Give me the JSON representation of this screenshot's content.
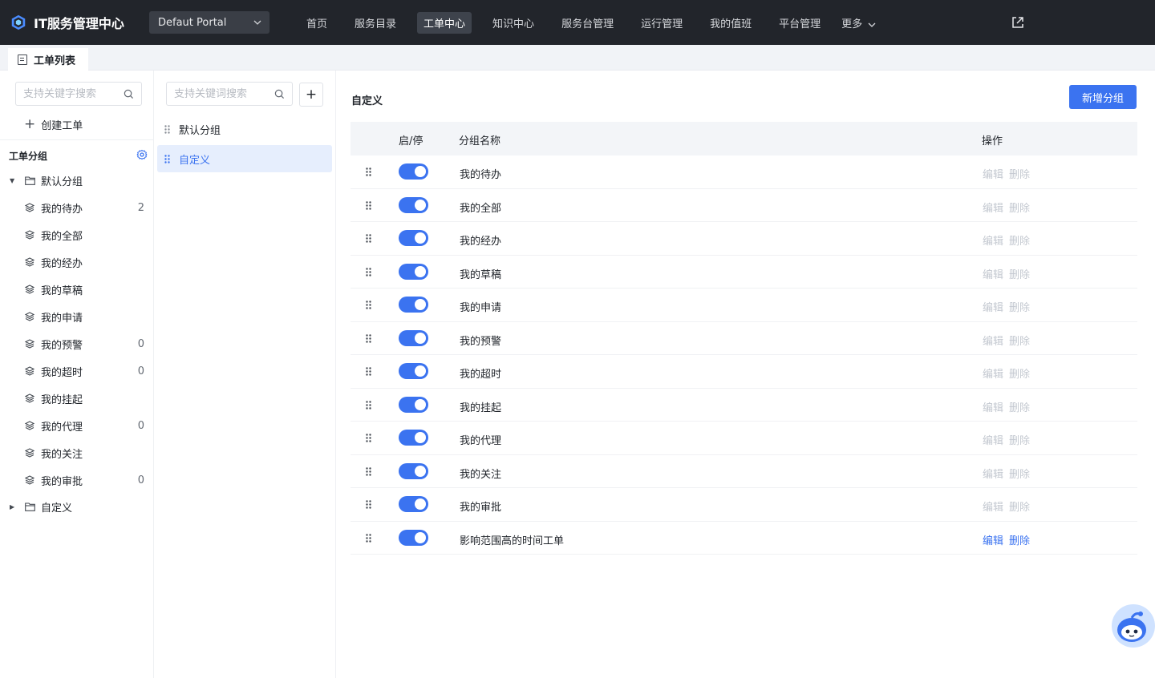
{
  "header": {
    "app_title": "IT服务管理中心",
    "portal_selected": "Defaut Portal",
    "nav": [
      "首页",
      "服务目录",
      "工单中心",
      "知识中心",
      "服务台管理",
      "运行管理",
      "我的值班",
      "平台管理"
    ],
    "active_nav": "工单中心",
    "more_label": "更多"
  },
  "tabs": {
    "active_tab": "工单列表"
  },
  "left": {
    "search_placeholder": "支持关键字搜索",
    "create_label": "创建工单",
    "group_title": "工单分组",
    "default_group": "默认分组",
    "items": [
      {
        "label": "我的待办",
        "count": "2"
      },
      {
        "label": "我的全部",
        "count": ""
      },
      {
        "label": "我的经办",
        "count": ""
      },
      {
        "label": "我的草稿",
        "count": ""
      },
      {
        "label": "我的申请",
        "count": ""
      },
      {
        "label": "我的预警",
        "count": "0"
      },
      {
        "label": "我的超时",
        "count": "0"
      },
      {
        "label": "我的挂起",
        "count": ""
      },
      {
        "label": "我的代理",
        "count": "0"
      },
      {
        "label": "我的关注",
        "count": ""
      },
      {
        "label": "我的审批",
        "count": "0"
      }
    ],
    "custom_group": "自定义"
  },
  "middle": {
    "search_placeholder": "支持关键词搜索",
    "add_label": "+",
    "groups": [
      {
        "label": "默认分组",
        "active": false
      },
      {
        "label": "自定义",
        "active": true
      }
    ]
  },
  "main": {
    "title": "自定义",
    "add_group_label": "新增分组",
    "columns": {
      "toggle": "启/停",
      "name": "分组名称",
      "ops": "操作"
    },
    "edit_label": "编辑",
    "delete_label": "删除",
    "rows": [
      {
        "name": "我的待办",
        "enabled": true,
        "ops_enabled": false
      },
      {
        "name": "我的全部",
        "enabled": true,
        "ops_enabled": false
      },
      {
        "name": "我的经办",
        "enabled": true,
        "ops_enabled": false
      },
      {
        "name": "我的草稿",
        "enabled": true,
        "ops_enabled": false
      },
      {
        "name": "我的申请",
        "enabled": true,
        "ops_enabled": false
      },
      {
        "name": "我的预警",
        "enabled": true,
        "ops_enabled": false
      },
      {
        "name": "我的超时",
        "enabled": true,
        "ops_enabled": false
      },
      {
        "name": "我的挂起",
        "enabled": true,
        "ops_enabled": false
      },
      {
        "name": "我的代理",
        "enabled": true,
        "ops_enabled": false
      },
      {
        "name": "我的关注",
        "enabled": true,
        "ops_enabled": false
      },
      {
        "name": "我的审批",
        "enabled": true,
        "ops_enabled": false
      },
      {
        "name": "影响范围高的时间工单",
        "enabled": true,
        "ops_enabled": true
      }
    ]
  },
  "colors": {
    "accent": "#3b73f0",
    "nav_bg": "#22252b",
    "disabled_text": "#c3c8d0"
  }
}
